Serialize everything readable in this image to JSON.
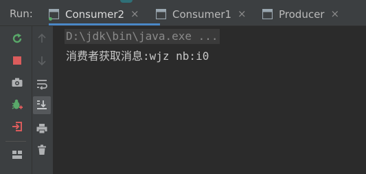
{
  "run_panel": {
    "label": "Run:",
    "tabs": [
      {
        "label": "Consumer2",
        "active": true,
        "icon": "app-run-icon",
        "close": "×"
      },
      {
        "label": "Consumer1",
        "active": false,
        "icon": "app-icon",
        "close": "×"
      },
      {
        "label": "Producer",
        "active": false,
        "icon": "app-icon",
        "close": "×"
      }
    ]
  },
  "toolbar_left": {
    "buttons": [
      {
        "name": "rerun-button",
        "icon": "rerun-icon",
        "color": "#59a869"
      },
      {
        "name": "stop-button",
        "icon": "stop-icon",
        "color": "#db5c5c"
      },
      {
        "name": "dump-threads-button",
        "icon": "camera-icon"
      },
      {
        "name": "debug-button",
        "icon": "bug-icon",
        "color": "#59a869"
      },
      {
        "name": "restore-layout-button",
        "icon": "exit-icon",
        "color": "#db5c5c"
      },
      {
        "name": "layout-button",
        "icon": "layout-icon"
      }
    ]
  },
  "toolbar_right": {
    "buttons": [
      {
        "name": "scroll-up-button",
        "icon": "arrow-up-icon",
        "enabled": false
      },
      {
        "name": "scroll-down-button",
        "icon": "arrow-down-icon",
        "enabled": false
      },
      {
        "name": "soft-wrap-button",
        "icon": "wrap-icon"
      },
      {
        "name": "scroll-to-end-button",
        "icon": "scroll-to-end-icon",
        "selected": true
      },
      {
        "name": "print-button",
        "icon": "print-icon"
      },
      {
        "name": "clear-all-button",
        "icon": "trash-icon"
      }
    ]
  },
  "console": {
    "command_line": "D:\\jdk\\bin\\java.exe ...",
    "output_lines": [
      "消费者获取消息:wjz nb:i0"
    ]
  },
  "colors": {
    "background": "#2b2b2b",
    "panel": "#3c3f41",
    "accent": "#4a88c7",
    "green": "#59a869",
    "red": "#db5c5c"
  }
}
